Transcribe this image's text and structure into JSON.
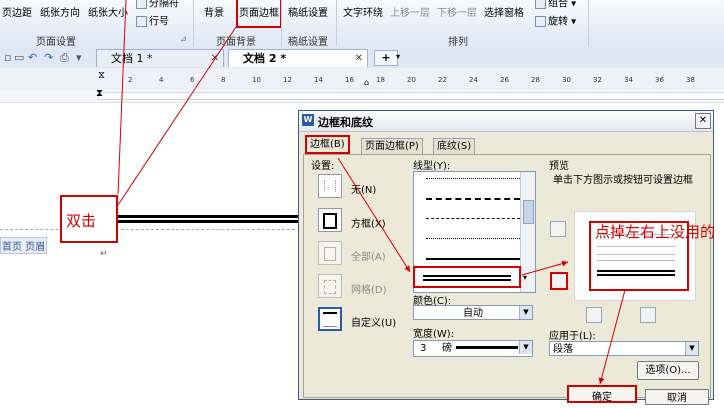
{
  "ribbon": {
    "page_margin": "页边距",
    "paper_orientation": "纸张方向",
    "paper_size": "纸张大小",
    "page_setup_group": "页面设置",
    "separator": "分隔符",
    "line_number": "行号",
    "background": "背景",
    "page_border": "页面边框",
    "page_background_group": "页面背景",
    "draft_settings": "稿纸设置",
    "draft_group": "稿纸设置",
    "text_wrap": "文字环绕",
    "bring_forward": "上移一层",
    "send_backward": "下移一层",
    "selection_pane": "选择窗格",
    "group": "组合",
    "rotate": "旋转",
    "arrange_group": "排列"
  },
  "tabs": [
    {
      "label": "文档 1 *"
    },
    {
      "label": "文档 2 *"
    }
  ],
  "new_tab": "+",
  "ruler_numbers": [
    "2",
    "4",
    "6",
    "8",
    "10",
    "12",
    "14",
    "16",
    "18",
    "20",
    "22",
    "24",
    "26",
    "28",
    "30",
    "32",
    "34",
    "36",
    "38"
  ],
  "doc": {
    "header_tag": "首页 页眉",
    "annotation_double_click": "双击",
    "annotation_remove": "点掉左右上没用的"
  },
  "dialog": {
    "title": "边框和底纹",
    "tabs": [
      "边框(B)",
      "页面边框(P)",
      "底纹(S)"
    ],
    "settings_label": "设置:",
    "settings": [
      "无(N)",
      "方框(X)",
      "全部(A)",
      "网格(D)",
      "自定义(U)"
    ],
    "line_style_label": "线型(Y):",
    "color_label": "颜色(C):",
    "color_value": "自动",
    "width_label": "宽度(W):",
    "width_value": "3",
    "width_unit": "磅",
    "preview_label": "预览",
    "preview_hint": "单击下方图示或按钮可设置边框",
    "apply_label": "应用于(L):",
    "apply_value": "段落",
    "options_button": "选项(O)...",
    "ok_button": "确定",
    "cancel_button": "取消"
  },
  "colors": {
    "annotation": "#d40000",
    "ribbon": "#dfe8f4",
    "dialog": "#ece9d8"
  }
}
